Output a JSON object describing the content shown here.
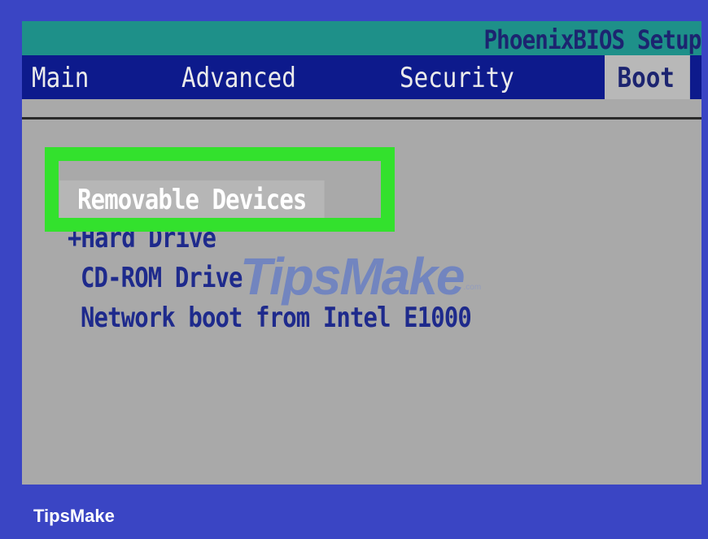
{
  "app": {
    "title": "PhoenixBIOS Setup"
  },
  "menu": {
    "items": [
      {
        "label": "Main",
        "active": false
      },
      {
        "label": "Advanced",
        "active": false
      },
      {
        "label": "Security",
        "active": false
      },
      {
        "label": "Boot",
        "active": true
      }
    ]
  },
  "boot": {
    "items": [
      {
        "label": "Removable Devices",
        "selected": true
      },
      {
        "label": "+Hard Drive",
        "selected": false
      },
      {
        "label": "CD-ROM Drive",
        "selected": false
      },
      {
        "label": "Network boot from Intel E1000",
        "selected": false
      }
    ]
  },
  "watermark": {
    "main": "TipsMake",
    "suffix": ".com"
  },
  "footer": {
    "brand": "TipsMake"
  },
  "colors": {
    "outer_background": "#3a45c4",
    "title_bar": "#1e9089",
    "menu_bar": "#0d1a8c",
    "screen_background": "#a9a9a9",
    "highlight_frame": "#33e12d",
    "boot_text": "#1e2a8c"
  }
}
